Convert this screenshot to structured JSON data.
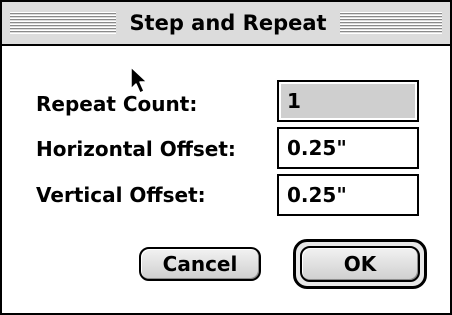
{
  "window": {
    "title": "Step and Repeat"
  },
  "fields": {
    "repeat_count": {
      "label": "Repeat Count:",
      "value": "1",
      "disabled": true
    },
    "horizontal_offset": {
      "label": "Horizontal Offset:",
      "value": "0.25\""
    },
    "vertical_offset": {
      "label": "Vertical Offset:",
      "value": "0.25\""
    }
  },
  "buttons": {
    "cancel_label": "Cancel",
    "ok_label": "OK",
    "default": "OK"
  },
  "icons": {
    "cursor": "arrow-cursor-icon"
  },
  "colors": {
    "titlebar": "#dcdcdc",
    "disabled_field": "#cfcfcf",
    "button_face": "#e0e0e0"
  }
}
